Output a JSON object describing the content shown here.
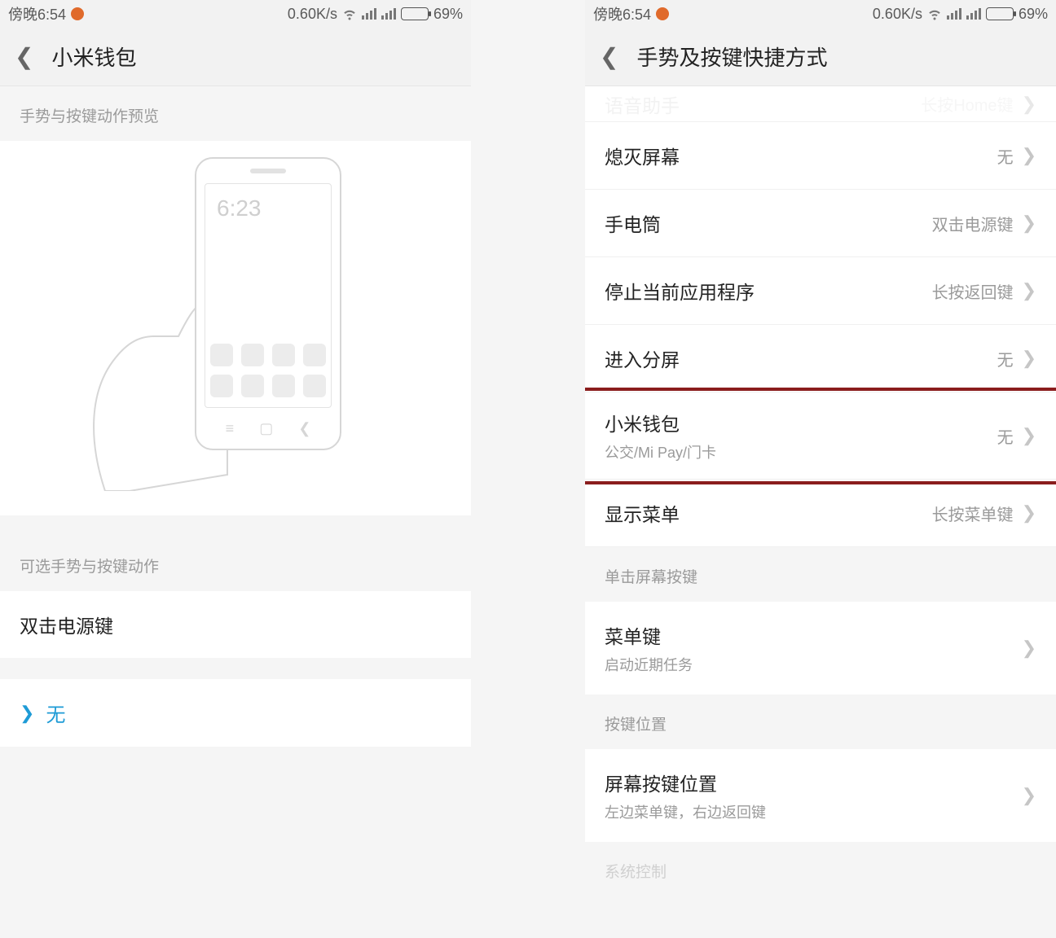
{
  "status": {
    "time": "傍晚6:54",
    "speed": "0.60K/s",
    "battery": "69%"
  },
  "left": {
    "title": "小米钱包",
    "preview_label": "手势与按键动作预览",
    "illust_time": "6:23",
    "actions_label": "可选手势与按键动作",
    "action1": "双击电源键",
    "selected": "无"
  },
  "right": {
    "title": "手势及按键快捷方式",
    "truncated_label": "语音助手",
    "truncated_value": "长按Home键",
    "rows": [
      {
        "label": "熄灭屏幕",
        "value": "无"
      },
      {
        "label": "手电筒",
        "value": "双击电源键"
      },
      {
        "label": "停止当前应用程序",
        "value": "长按返回键"
      },
      {
        "label": "进入分屏",
        "value": "无"
      },
      {
        "label": "小米钱包",
        "sub": "公交/Mi Pay/门卡",
        "value": "无",
        "highlight": true
      },
      {
        "label": "显示菜单",
        "value": "长按菜单键"
      }
    ],
    "sec2_label": "单击屏幕按键",
    "sec2_row": {
      "label": "菜单键",
      "sub": "启动近期任务"
    },
    "sec3_label": "按键位置",
    "sec3_row": {
      "label": "屏幕按键位置",
      "sub": "左边菜单键，右边返回键"
    },
    "truncated_bottom": "系统控制"
  }
}
